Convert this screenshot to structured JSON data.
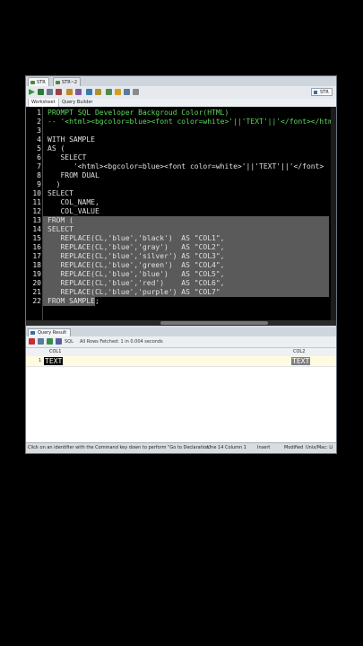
{
  "tabs": [
    {
      "label": "STR"
    },
    {
      "label": "STR~2"
    }
  ],
  "connection": {
    "label": "STR"
  },
  "subtabs": [
    {
      "label": "Worksheet"
    },
    {
      "label": "Query Builder"
    }
  ],
  "editor": {
    "lines": [
      {
        "num": "1",
        "text": "PROMPT SQL Developer Backgroud Color(HTML)"
      },
      {
        "num": "2",
        "text": "-- '<html><bgcolor=blue><font color=white>'||'TEXT'||'</font></htm"
      },
      {
        "num": "3",
        "text": ""
      },
      {
        "num": "4",
        "text": "WITH SAMPLE"
      },
      {
        "num": "5",
        "text": "AS ("
      },
      {
        "num": "6",
        "text": "   SELECT"
      },
      {
        "num": "7",
        "text": "      '<html><bgcolor=blue><font color=white>'||'TEXT'||'</font>"
      },
      {
        "num": "8",
        "text": "   FROM DUAL"
      },
      {
        "num": "9",
        "text": "  )"
      },
      {
        "num": "10",
        "text": "SELECT"
      },
      {
        "num": "11",
        "text": "   COL_NAME,"
      },
      {
        "num": "12",
        "text": "   COL_VALUE"
      },
      {
        "num": "13",
        "text": "FROM ("
      },
      {
        "num": "14",
        "text": "SELECT"
      },
      {
        "num": "15",
        "text": "   REPLACE(CL,'blue','black')  AS \"COL1\","
      },
      {
        "num": "16",
        "text": "   REPLACE(CL,'blue','gray')   AS \"COL2\","
      },
      {
        "num": "17",
        "text": "   REPLACE(CL,'blue','silver') AS \"COL3\","
      },
      {
        "num": "18",
        "text": "   REPLACE(CL,'blue','green')  AS \"COL4\","
      },
      {
        "num": "19",
        "text": "   REPLACE(CL,'blue','blue')   AS \"COL5\","
      },
      {
        "num": "20",
        "text": "   REPLACE(CL,'blue','red')    AS \"COL6\","
      },
      {
        "num": "21",
        "text": "   REPLACE(CL,'blue','purple') AS \"COL7\""
      },
      {
        "num": "22",
        "text": "FROM SAMPLE;"
      }
    ]
  },
  "results": {
    "tab_label": "Query Result",
    "sql_label": "SQL",
    "fetch_status": "All Rows Fetched: 1 in 0.004 seconds",
    "columns": [
      {
        "label": "COL1"
      },
      {
        "label": "COL2"
      }
    ],
    "rows": [
      {
        "num": "1",
        "col1": "TEXT",
        "col2": "TEXT"
      }
    ]
  },
  "statusbar": {
    "hint": "Click on an identifier with the Command key down to perform \"Go to Declaration\"",
    "position": "Line 14 Column 1",
    "mode": "Insert",
    "modified": "Modified",
    "encoding": "Unix/Mac: LI"
  },
  "colors": {
    "editor_bg": "#000000",
    "comment": "#5fd75f",
    "code_text": "#e0e0e0",
    "selection": "#5a5a5a",
    "col1_bg": "#000000",
    "col2_bg": "#808080"
  }
}
